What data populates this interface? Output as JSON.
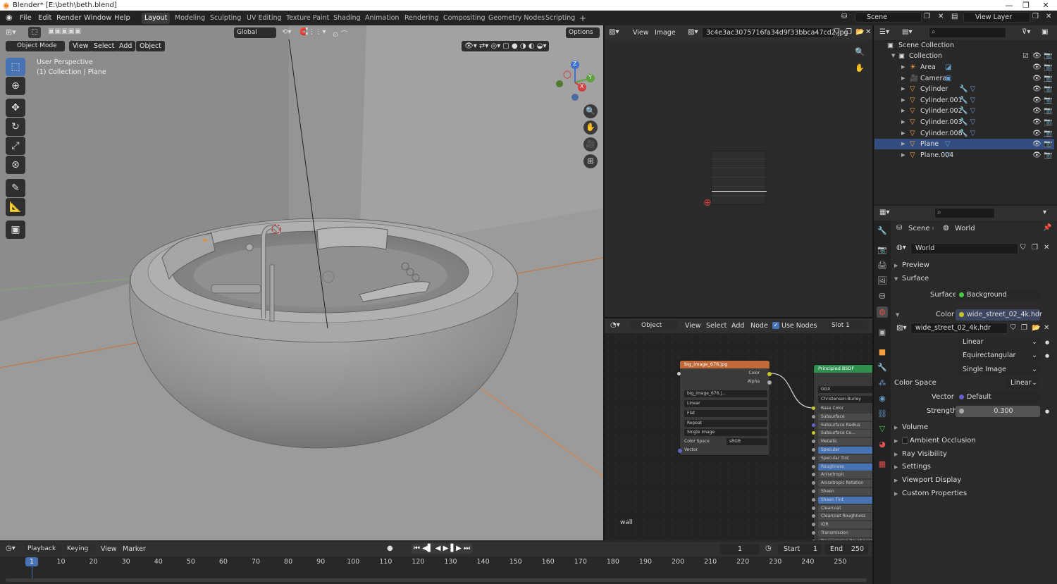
{
  "window": {
    "title": "Blender* [E:\\beth\\beth.blend]"
  },
  "menu": [
    "File",
    "Edit",
    "Render",
    "Window",
    "Help"
  ],
  "workspaces": [
    "Layout",
    "Modeling",
    "Sculpting",
    "UV Editing",
    "Texture Paint",
    "Shading",
    "Animation",
    "Rendering",
    "Compositing",
    "Geometry Nodes",
    "Scripting"
  ],
  "scene_field": "Scene",
  "view_layer_field": "View Layer",
  "viewport": {
    "transform_orientation": "Global",
    "options_label": "Options",
    "mode": "Object Mode",
    "menus": [
      "View",
      "Select",
      "Add",
      "Object"
    ],
    "overlay_line1": "User Perspective",
    "overlay_line2": "(1) Collection | Plane",
    "axes": [
      "Z",
      "Y",
      "X"
    ]
  },
  "image_editor": {
    "menus": [
      "View",
      "Image"
    ],
    "image_name": "3c4e3ac3075716fa34d9f33bbca47cd2.jpg"
  },
  "node_editor": {
    "object_dropdown": "Object",
    "menus": [
      "View",
      "Select",
      "Add",
      "Node"
    ],
    "use_nodes_label": "Use Nodes",
    "slot": "Slot 1",
    "frame_label": "wall",
    "image_node": {
      "title": "big_image_676.jpg",
      "out_color": "Color",
      "out_alpha": "Alpha",
      "image": "big_image_676.j...",
      "interp": "Linear",
      "proj": "Flat",
      "ext": "Repeat",
      "source": "Single Image",
      "cs_label": "Color Space",
      "cs_value": "sRGB",
      "vector": "Vector"
    },
    "bsdf_node": {
      "title": "Principled BSDF",
      "dist": "GGX",
      "sss": "Christensen-Burley",
      "inputs": [
        "Base Color",
        "Subsurface",
        "Subsurface Radius",
        "Subsurface Co...",
        "Metallic",
        "Specular",
        "Specular Tint",
        "Roughness",
        "Anisotropic",
        "Anisotropic Rotation",
        "Sheen",
        "Sheen Tint",
        "Clearcoat",
        "Clearcoat Roughness",
        "IOR",
        "Transmission",
        "Transmission Roughness"
      ]
    }
  },
  "outliner": {
    "scene_collection": "Scene Collection",
    "collection": "Collection",
    "items": [
      {
        "name": "Area",
        "icon": "light-icon",
        "selected": false
      },
      {
        "name": "Camera",
        "icon": "camera-object-icon",
        "selected": false
      },
      {
        "name": "Cylinder",
        "icon": "mesh-icon",
        "selected": false
      },
      {
        "name": "Cylinder.001",
        "icon": "mesh-icon",
        "selected": false
      },
      {
        "name": "Cylinder.002",
        "icon": "mesh-icon",
        "selected": false
      },
      {
        "name": "Cylinder.003",
        "icon": "mesh-icon",
        "selected": false
      },
      {
        "name": "Cylinder.008",
        "icon": "mesh-icon",
        "selected": false
      },
      {
        "name": "Plane",
        "icon": "mesh-icon",
        "selected": true
      },
      {
        "name": "Plane.004",
        "icon": "mesh-icon",
        "selected": false
      }
    ]
  },
  "properties": {
    "breadcrumb_scene": "Scene",
    "breadcrumb_world": "World",
    "world_name": "World",
    "preview": "Preview",
    "surface": "Surface",
    "surface_label": "Surface",
    "surface_value": "Background",
    "color_label": "Color",
    "color_value": "wide_street_02_4k.hdr",
    "image_name": "wide_street_02_4k.hdr",
    "interp": "Linear",
    "projection": "Equirectangular",
    "source": "Single Image",
    "color_space_label": "Color Space",
    "color_space_value": "Linear",
    "vector_label": "Vector",
    "vector_value": "Default",
    "strength_label": "Strength",
    "strength_value": "0.300",
    "panels": [
      "Volume",
      "Ambient Occlusion",
      "Ray Visibility",
      "Settings",
      "Viewport Display",
      "Custom Properties"
    ]
  },
  "timeline": {
    "menus": [
      "Playback",
      "Keying",
      "View",
      "Marker"
    ],
    "current_frame": "1",
    "start_label": "Start",
    "start": "1",
    "end_label": "End",
    "end": "250",
    "ticks": [
      "1",
      "10",
      "20",
      "30",
      "40",
      "50",
      "60",
      "70",
      "80",
      "90",
      "100",
      "110",
      "120",
      "130",
      "140",
      "150",
      "160",
      "170",
      "180",
      "190",
      "200",
      "210",
      "220",
      "230",
      "240",
      "250"
    ]
  },
  "colors": {
    "accent": "#4772b3",
    "selected_row": "#334d80",
    "orange": "#f0a040",
    "image_node_header": "#c06a3a",
    "bsdf_header": "#2f8f4f"
  }
}
